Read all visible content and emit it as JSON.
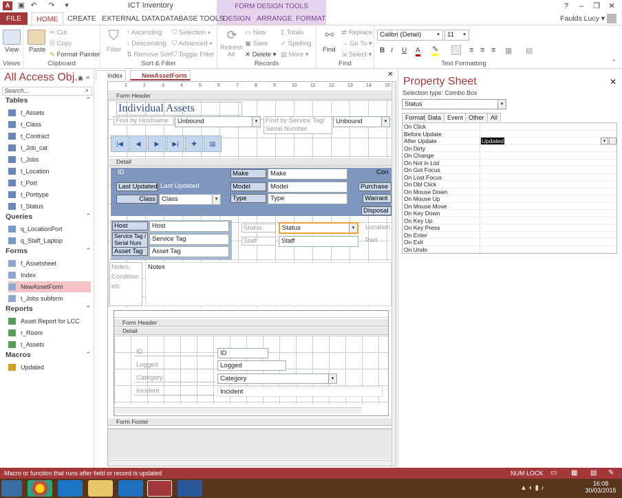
{
  "window": {
    "title": "ICT Inventory",
    "context_group": "FORM DESIGN TOOLS",
    "help": "?",
    "user": "Faulds Lucy"
  },
  "tabs": [
    "FILE",
    "HOME",
    "CREATE",
    "EXTERNAL DATA",
    "DATABASE TOOLS",
    "DESIGN",
    "ARRANGE",
    "FORMAT"
  ],
  "ribbon": {
    "views": {
      "label": "Views",
      "view": "View"
    },
    "clipboard": {
      "label": "Clipboard",
      "paste": "Paste",
      "cut": "Cut",
      "copy": "Copy",
      "format_painter": "Format Painter"
    },
    "sort_filter": {
      "label": "Sort & Filter",
      "filter": "Filter",
      "ascending": "Ascending",
      "descending": "Descending",
      "remove_sort": "Remove Sort",
      "selection": "Selection",
      "advanced": "Advanced",
      "toggle_filter": "Toggle Filter"
    },
    "records": {
      "label": "Records",
      "refresh": "Refresh All",
      "new": "New",
      "save": "Save",
      "delete": "Delete",
      "totals": "Totals",
      "spelling": "Spelling",
      "more": "More"
    },
    "find": {
      "label": "Find",
      "find": "Find",
      "replace": "Replace",
      "goto": "Go To",
      "select": "Select"
    },
    "text_formatting": {
      "label": "Text Formatting",
      "font": "Calibri (Detail)",
      "size": "11",
      "bold": "B",
      "italic": "I",
      "underline": "U",
      "font_color": "A"
    }
  },
  "nav": {
    "title": "All Access Obj...",
    "search_placeholder": "Search...",
    "categories": [
      {
        "name": "Tables",
        "items": [
          "t_Assets",
          "t_Class",
          "t_Contract",
          "t_Job_cat",
          "t_Jobs",
          "t_Location",
          "t_Port",
          "t_Porttype",
          "t_Status"
        ]
      },
      {
        "name": "Queries",
        "items": [
          "q_LocationPort",
          "q_Staff_Laptop"
        ]
      },
      {
        "name": "Forms",
        "items": [
          "f_Assetsheet",
          "Index",
          "NewAssetForm",
          "t_Jobs subform"
        ]
      },
      {
        "name": "Reports",
        "items": [
          "Asset Report for LCC",
          "r_Room",
          "t_Assets"
        ]
      },
      {
        "name": "Macros",
        "items": [
          "Updated"
        ]
      }
    ],
    "selected": "NewAssetForm"
  },
  "doc_tabs": [
    "Index",
    "NewAssetForm"
  ],
  "form": {
    "sections": {
      "header": "Form Header",
      "detail": "Detail",
      "footer": "Form Footer",
      "sub_header": "Form Header",
      "sub_detail": "Detail"
    },
    "ruler": [
      "1",
      "2",
      "3",
      "4",
      "5",
      "6",
      "7",
      "8",
      "9",
      "10",
      "11",
      "12",
      "13",
      "14",
      "15"
    ],
    "heading": "Individual Assets",
    "find_host_label": "Find by Hostname",
    "find_host_value": "Unbound",
    "find_service_label": "Find by Service Tag/ Serial Number",
    "find_service_value": "Unbound",
    "nav_buttons": [
      "|◀",
      "◀",
      "▶",
      "▶|",
      "✚",
      "▤"
    ],
    "fields": {
      "id_label": "ID",
      "last_updated_label": "Last Updated",
      "last_updated_value": "Last Updated",
      "class_label": "Class",
      "class_value": "Class",
      "make_label": "Make",
      "make_value": "Make",
      "model_label": "Model",
      "model_value": "Model",
      "type_label": "Type",
      "type_value": "Type",
      "con_label": "Con",
      "purchase_label": "Purchase",
      "warranty_label": "Warrant",
      "disposal_label": "Disposal",
      "host_label": "Host",
      "host_value": "Host",
      "service_label": "Service Tag / Serial Num",
      "service_value": "Service Tag",
      "asset_label": "Asset Tag",
      "asset_value": "Asset Tag",
      "status_label": "Status",
      "status_value": "Status",
      "staff_label": "Staff",
      "staff_value": "Staff",
      "location_label": "Location",
      "port_label": "Port",
      "notes_label": "Notes, Condition etc",
      "notes_value": "Notes"
    },
    "subform": {
      "id_label": "ID",
      "id_value": "ID",
      "logged_label": "Logged",
      "logged_value": "Logged",
      "category_label": "Category",
      "category_value": "Category",
      "incident_label": "Incident",
      "incident_value": "Incident"
    }
  },
  "property_sheet": {
    "title": "Property Sheet",
    "selection_type": "Selection type:  Combo Box",
    "selected_control": "Status",
    "tabs": [
      "Format",
      "Data",
      "Event",
      "Other",
      "All"
    ],
    "active_tab": "Event",
    "events": [
      {
        "k": "On Click",
        "v": ""
      },
      {
        "k": "Before Update",
        "v": ""
      },
      {
        "k": "After Update",
        "v": "Updated"
      },
      {
        "k": "On Dirty",
        "v": ""
      },
      {
        "k": "On Change",
        "v": ""
      },
      {
        "k": "On Not in List",
        "v": ""
      },
      {
        "k": "On Got Focus",
        "v": ""
      },
      {
        "k": "On Lost Focus",
        "v": ""
      },
      {
        "k": "On Dbl Click",
        "v": ""
      },
      {
        "k": "On Mouse Down",
        "v": ""
      },
      {
        "k": "On Mouse Up",
        "v": ""
      },
      {
        "k": "On Mouse Move",
        "v": ""
      },
      {
        "k": "On Key Down",
        "v": ""
      },
      {
        "k": "On Key Up",
        "v": ""
      },
      {
        "k": "On Key Press",
        "v": ""
      },
      {
        "k": "On Enter",
        "v": ""
      },
      {
        "k": "On Exit",
        "v": ""
      },
      {
        "k": "On Undo",
        "v": ""
      }
    ]
  },
  "statusbar": {
    "message": "Macro or function that runs after field or record is updated",
    "numlock": "NUM LOCK"
  },
  "taskbar": {
    "time": "16:08",
    "date": "30/03/2015"
  },
  "colors": {
    "access_red": "#a4373a",
    "form_blue": "#7f97be",
    "selected_nav": "#f5c2c6",
    "context_tab": "#e6d4ee"
  }
}
